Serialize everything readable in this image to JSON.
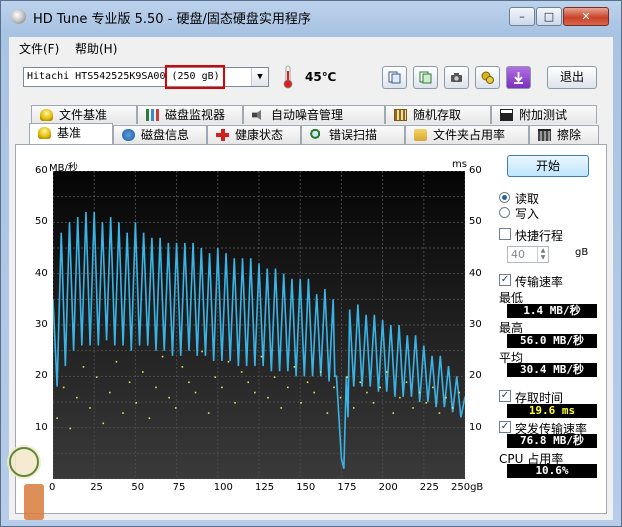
{
  "window": {
    "title": "HD Tune 专业版 5.50 - 硬盘/固态硬盘实用程序",
    "minimize": "–",
    "maximize": "□",
    "close": "✕"
  },
  "menu": {
    "items": [
      "文件(F)",
      "帮助(H)"
    ]
  },
  "toolbar": {
    "drive": "Hitachi HTS542525K9SA00 (250 gB)",
    "temperature": "45℃",
    "exit_label": "退出",
    "buttons": [
      "copy-info-icon",
      "copy-screenshot-icon",
      "camera-icon",
      "drive-options-icon",
      "download-icon"
    ]
  },
  "tabs": {
    "row1": [
      "文件基准",
      "磁盘监视器",
      "自动噪音管理",
      "随机存取",
      "附加测试"
    ],
    "row2": [
      "基准",
      "磁盘信息",
      "健康状态",
      "错误扫描",
      "文件夹占用率",
      "擦除"
    ],
    "active": "基准"
  },
  "benchmark": {
    "start_label": "开始",
    "read_label": "读取",
    "write_label": "写入",
    "short_stroke_label": "快捷行程",
    "short_stroke_value": "40",
    "short_stroke_unit": "gB",
    "transfer_rate_label": "传输速率",
    "min_label": "最低",
    "min_value": "1.4 MB/秒",
    "max_label": "最高",
    "max_value": "56.0 MB/秒",
    "avg_label": "平均",
    "avg_value": "30.4 MB/秒",
    "access_time_label": "存取时间",
    "access_time_value": "19.6 ms",
    "burst_label": "突发传输速率",
    "burst_value": "76.8 MB/秒",
    "cpu_label": "CPU 占用率",
    "cpu_value": "10.6%"
  },
  "chart_data": {
    "type": "line",
    "ylabel": "MB/秒",
    "y2label": "ms",
    "x_ticks": [
      "0",
      "25",
      "50",
      "75",
      "100",
      "125",
      "150",
      "175",
      "200",
      "225",
      "250gB"
    ],
    "y_ticks": [
      "60",
      "50",
      "40",
      "30",
      "20",
      "10"
    ],
    "y2_ticks": [
      "60",
      "50",
      "40",
      "30",
      "20",
      "10"
    ],
    "xlim": [
      0,
      250
    ],
    "ylim": [
      0,
      60
    ],
    "y2lim": [
      0,
      60
    ],
    "grid": true,
    "series": [
      {
        "color": "#3ab4e6",
        "x": [
          0,
          5,
          10,
          15,
          20,
          25,
          30,
          35,
          40,
          45,
          50,
          55,
          60,
          65,
          70,
          75,
          80,
          85,
          90,
          95,
          100,
          105,
          110,
          115,
          120,
          125,
          130,
          135,
          140,
          145,
          150,
          155,
          160,
          165,
          170,
          172,
          175,
          178,
          180,
          185,
          190,
          195,
          200,
          205,
          210,
          215,
          220,
          225,
          230,
          235,
          240,
          245,
          250
        ],
        "y": [
          35,
          48,
          50,
          51,
          52,
          52,
          50,
          51,
          50,
          48,
          50,
          48,
          47,
          47,
          46,
          46,
          46,
          46,
          45,
          44,
          45,
          44,
          43,
          43,
          43,
          42,
          41,
          41,
          40,
          39,
          39,
          39,
          36,
          37,
          35,
          20,
          4,
          20,
          33,
          34,
          32,
          32,
          31,
          30,
          30,
          28,
          28,
          26,
          24,
          24,
          22,
          20,
          16
        ]
      },
      {
        "color": "#3ab4e6",
        "x": [
          0,
          5,
          10,
          15,
          20,
          25,
          30,
          35,
          40,
          45,
          50,
          55,
          60,
          65,
          70,
          75,
          80,
          85,
          90,
          95,
          100,
          105,
          110,
          115,
          120,
          125,
          130,
          135,
          140,
          145,
          150,
          155,
          160,
          165,
          170,
          172,
          175,
          178,
          180,
          185,
          190,
          195,
          200,
          205,
          210,
          215,
          220,
          225,
          230,
          235,
          240,
          245,
          250
        ],
        "y": [
          18,
          22,
          25,
          26,
          26,
          26,
          27,
          26,
          26,
          25,
          26,
          26,
          25,
          25,
          24,
          24,
          25,
          24,
          24,
          23,
          23,
          23,
          22,
          22,
          22,
          22,
          21,
          21,
          21,
          20,
          20,
          20,
          20,
          19,
          20,
          12,
          2,
          12,
          18,
          18,
          18,
          17,
          17,
          16,
          16,
          16,
          15,
          15,
          14,
          14,
          13,
          12,
          10
        ]
      },
      {
        "color": "#e2e25a",
        "x": [
          2,
          6,
          10,
          14,
          18,
          22,
          26,
          30,
          34,
          38,
          42,
          46,
          50,
          54,
          58,
          62,
          66,
          70,
          74,
          78,
          82,
          86,
          90,
          94,
          98,
          102,
          106,
          110,
          114,
          118,
          122,
          126,
          130,
          134,
          138,
          142,
          146,
          150,
          154,
          158,
          162,
          166,
          170,
          174,
          178,
          182,
          186,
          190,
          194,
          198,
          202,
          206,
          210,
          214,
          218,
          222,
          226,
          230,
          234,
          238,
          242,
          246
        ],
        "y": [
          12,
          18,
          10,
          16,
          22,
          14,
          20,
          11,
          17,
          23,
          13,
          19,
          15,
          21,
          12,
          18,
          24,
          16,
          14,
          22,
          19,
          17,
          25,
          13,
          20,
          18,
          23,
          15,
          21,
          19,
          17,
          24,
          16,
          20,
          14,
          18,
          22,
          15,
          19,
          17,
          21,
          13,
          18,
          16,
          20,
          14,
          19,
          17,
          15,
          18,
          21,
          13,
          16,
          19,
          14,
          17,
          15,
          18,
          13,
          16,
          14,
          17
        ]
      }
    ]
  }
}
